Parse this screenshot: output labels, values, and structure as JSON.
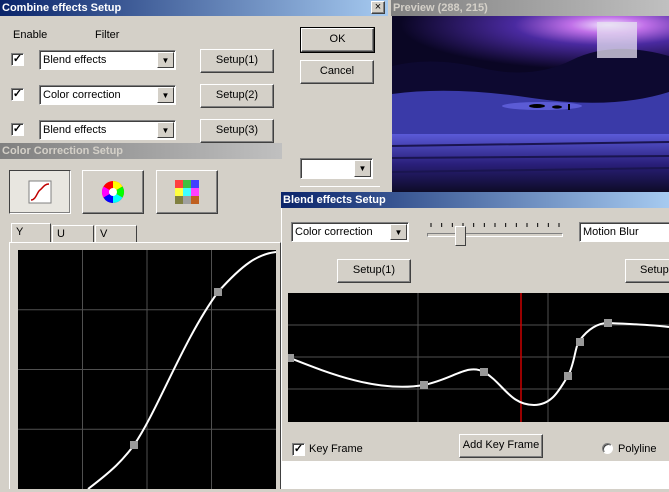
{
  "combine": {
    "title": "Combine effects Setup",
    "close_glyph": "×",
    "enable_label": "Enable",
    "filter_label": "Filter",
    "rows": [
      {
        "checked": true,
        "filter": "Blend effects",
        "setup": "Setup(1)"
      },
      {
        "checked": true,
        "filter": "Color correction",
        "setup": "Setup(2)"
      },
      {
        "checked": true,
        "filter": "Blend effects",
        "setup": "Setup(3)"
      }
    ],
    "ok": "OK",
    "cancel": "Cancel",
    "extra_combo": ""
  },
  "preview": {
    "title": "Preview (288, 215)"
  },
  "color_correction": {
    "title": "Color Correction Setup",
    "tools": [
      "curve-icon",
      "color-wheel-icon",
      "color-grid-icon"
    ],
    "tabs": [
      "Y",
      "U",
      "V"
    ],
    "active_tab": "Y"
  },
  "blend": {
    "title": "Blend effects Setup",
    "left_filter": "Color correction",
    "right_filter": "Motion Blur",
    "setup_left": "Setup(1)",
    "setup_right": "Setup",
    "key_frame_label": "Key Frame",
    "key_frame_checked": true,
    "add_key_frame": "Add Key Frame",
    "polyline_label": "Polyline",
    "slider_value": 0.22
  },
  "colors": {
    "title_active": "#0a246a",
    "title_inactive": "#808080",
    "graph_bg": "#000000",
    "curve": "#ffffff",
    "marker": "#cc0000"
  }
}
